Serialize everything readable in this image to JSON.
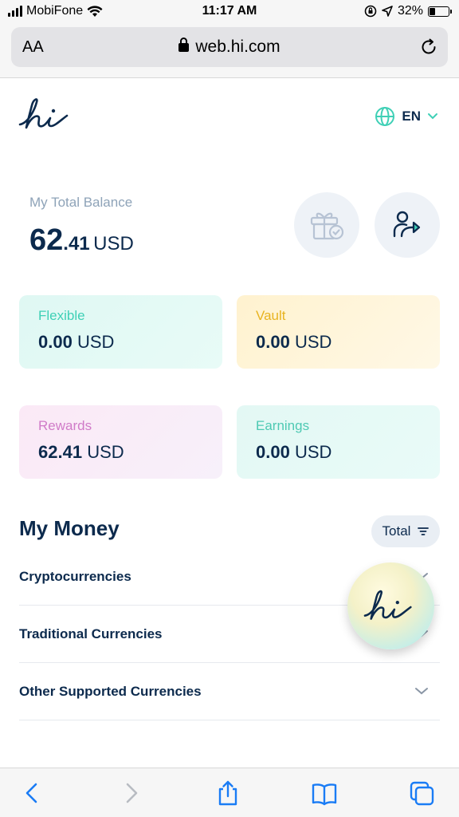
{
  "status_bar": {
    "carrier": "MobiFone",
    "time": "11:17 AM",
    "battery": "32%",
    "battery_level": 0.32
  },
  "browser": {
    "text_size_label": "AA",
    "url": "web.hi.com"
  },
  "header": {
    "language": "EN"
  },
  "balance": {
    "label": "My Total Balance",
    "integer": "62",
    "decimal": ".41",
    "currency": "USD"
  },
  "cards": {
    "flexible": {
      "label": "Flexible",
      "amount": "0.00",
      "currency": "USD"
    },
    "vault": {
      "label": "Vault",
      "amount": "0.00",
      "currency": "USD"
    },
    "rewards": {
      "label": "Rewards",
      "amount": "62.41",
      "currency": "USD"
    },
    "earnings": {
      "label": "Earnings",
      "amount": "0.00",
      "currency": "USD"
    }
  },
  "my_money": {
    "title": "My Money",
    "filter_label": "Total",
    "sections": [
      {
        "label": "Cryptocurrencies"
      },
      {
        "label": "Traditional Currencies"
      },
      {
        "label": "Other Supported Currencies"
      }
    ]
  },
  "colors": {
    "navy": "#0c2a4d",
    "teal": "#3fd0b6",
    "gold": "#e8b320",
    "pink": "#d07bc8",
    "muted": "#8ea3b8",
    "ios_blue": "#1a7cf5"
  },
  "icons": [
    "wifi-icon",
    "signal-icon",
    "lock-icon",
    "reload-icon",
    "globe-icon",
    "chevron-down-icon",
    "gift-icon",
    "share-user-icon",
    "filter-icon",
    "back-icon",
    "forward-icon",
    "share-icon",
    "bookmarks-icon",
    "tabs-icon"
  ]
}
